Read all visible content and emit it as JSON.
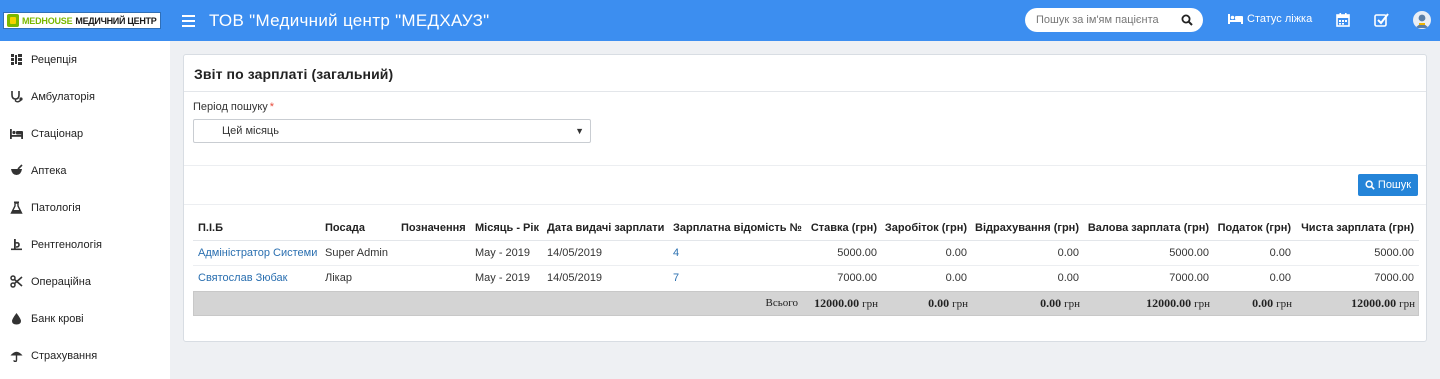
{
  "header": {
    "logo_brand": "MEDHOUSE",
    "logo_sub": "МЕДИЧНИЙ ЦЕНТР",
    "app_title": "ТОВ \"Медичний центр \"МЕДХАУЗ\"",
    "search_placeholder": "Пошук за ім'ям пацієнта",
    "bed_status_label": "Статус ліжка",
    "icons": [
      "menu-icon",
      "search-icon",
      "bed-icon",
      "calendar-icon",
      "checkbox-icon",
      "user-avatar"
    ],
    "color": "#3c8ef0"
  },
  "sidebar": {
    "items": [
      {
        "label": "Рецепція",
        "icon": "sitemap-icon"
      },
      {
        "label": "Амбулаторія",
        "icon": "stethoscope-icon"
      },
      {
        "label": "Стаціонар",
        "icon": "bed-icon"
      },
      {
        "label": "Аптека",
        "icon": "mortar-icon"
      },
      {
        "label": "Патологія",
        "icon": "flask-icon"
      },
      {
        "label": "Рентгенологія",
        "icon": "xray-icon"
      },
      {
        "label": "Операційна",
        "icon": "scissors-icon"
      },
      {
        "label": "Банк крові",
        "icon": "drop-icon"
      },
      {
        "label": "Страхування",
        "icon": "umbrella-icon"
      }
    ]
  },
  "main": {
    "title": "Звіт по зарплаті (загальний)",
    "period_label": "Період пошуку",
    "period_required_mark": "*",
    "period_value": "Цей місяць",
    "search_button": "Пошук",
    "table": {
      "columns": [
        "П.І.Б",
        "Посада",
        "Позначення",
        "Місяць - Рік",
        "Дата видачі зарплати",
        "Зарплатна відомість №",
        "Ставка (грн)",
        "Заробіток (грн)",
        "Відрахування (грн)",
        "Валова зарплата (грн)",
        "Податок (грн)",
        "Чиста зарплата (грн)"
      ],
      "rows": [
        {
          "name": "Адміністратор Системи",
          "position": "Super Admin",
          "designation": "",
          "month_year": "May - 2019",
          "pay_date": "14/05/2019",
          "sheet_no": "4",
          "rate": "5000.00",
          "earnings": "0.00",
          "deductions": "0.00",
          "gross": "5000.00",
          "tax": "0.00",
          "net": "5000.00"
        },
        {
          "name": "Святослав Зюбак",
          "position": "Лікар",
          "designation": "",
          "month_year": "May - 2019",
          "pay_date": "14/05/2019",
          "sheet_no": "7",
          "rate": "7000.00",
          "earnings": "0.00",
          "deductions": "0.00",
          "gross": "7000.00",
          "tax": "0.00",
          "net": "7000.00"
        }
      ],
      "totals": {
        "label": "Всього",
        "currency": "грн",
        "rate": "12000.00",
        "earnings": "0.00",
        "deductions": "0.00",
        "gross": "12000.00",
        "tax": "0.00",
        "net": "12000.00"
      }
    }
  }
}
